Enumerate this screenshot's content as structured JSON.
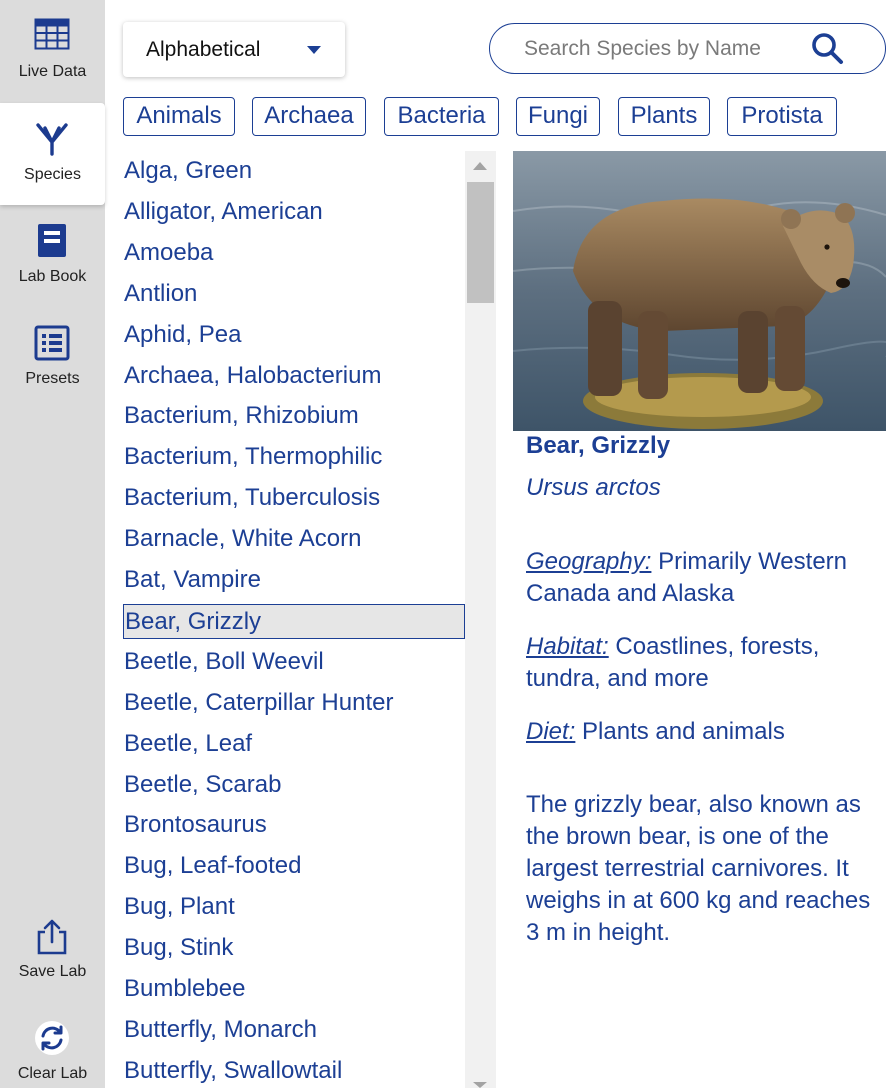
{
  "nav": {
    "items": [
      {
        "label": "Live Data",
        "icon": "table-icon"
      },
      {
        "label": "Species",
        "icon": "species-icon"
      },
      {
        "label": "Lab Book",
        "icon": "lab-book-icon"
      },
      {
        "label": "Presets",
        "icon": "presets-icon"
      },
      {
        "label": "Save Lab",
        "icon": "share-icon"
      },
      {
        "label": "Clear Lab",
        "icon": "refresh-icon"
      }
    ],
    "active": "Species"
  },
  "sort": {
    "label": "Alphabetical"
  },
  "search": {
    "placeholder": "Search Species by Name"
  },
  "filters": [
    "Animals",
    "Archaea",
    "Bacteria",
    "Fungi",
    "Plants",
    "Protista"
  ],
  "species_list": {
    "items": [
      "Alga, Green",
      "Alligator, American",
      "Amoeba",
      "Antlion",
      "Aphid, Pea",
      "Archaea, Halobacterium",
      "Bacterium, Rhizobium",
      "Bacterium, Thermophilic",
      "Bacterium, Tuberculosis",
      "Barnacle, White Acorn",
      "Bat, Vampire",
      "Bear, Grizzly",
      "Beetle, Boll Weevil",
      "Beetle, Caterpillar Hunter",
      "Beetle, Leaf",
      "Beetle, Scarab",
      "Brontosaurus",
      "Bug, Leaf-footed",
      "Bug, Plant",
      "Bug, Stink",
      "Bumblebee",
      "Butterfly, Monarch",
      "Butterfly, Swallowtail"
    ],
    "selected": "Bear, Grizzly"
  },
  "detail": {
    "common_name": "Bear, Grizzly",
    "scientific_name": "Ursus arctos",
    "geography_label": "Geography:",
    "geography": "Primarily Western Canada and Alaska",
    "habitat_label": "Habitat:",
    "habitat": "Coastlines, forests, tundra, and more",
    "diet_label": "Diet:",
    "diet": "Plants and animals",
    "description": "The grizzly bear, also known as the brown bear, is one of the largest terrestrial carnivores. It weighs in at 600 kg and reaches 3 m in height."
  },
  "colors": {
    "accent": "#1c3f94",
    "sidebar_bg": "#dcdcdc",
    "selected_bg": "#e6e6e6"
  }
}
